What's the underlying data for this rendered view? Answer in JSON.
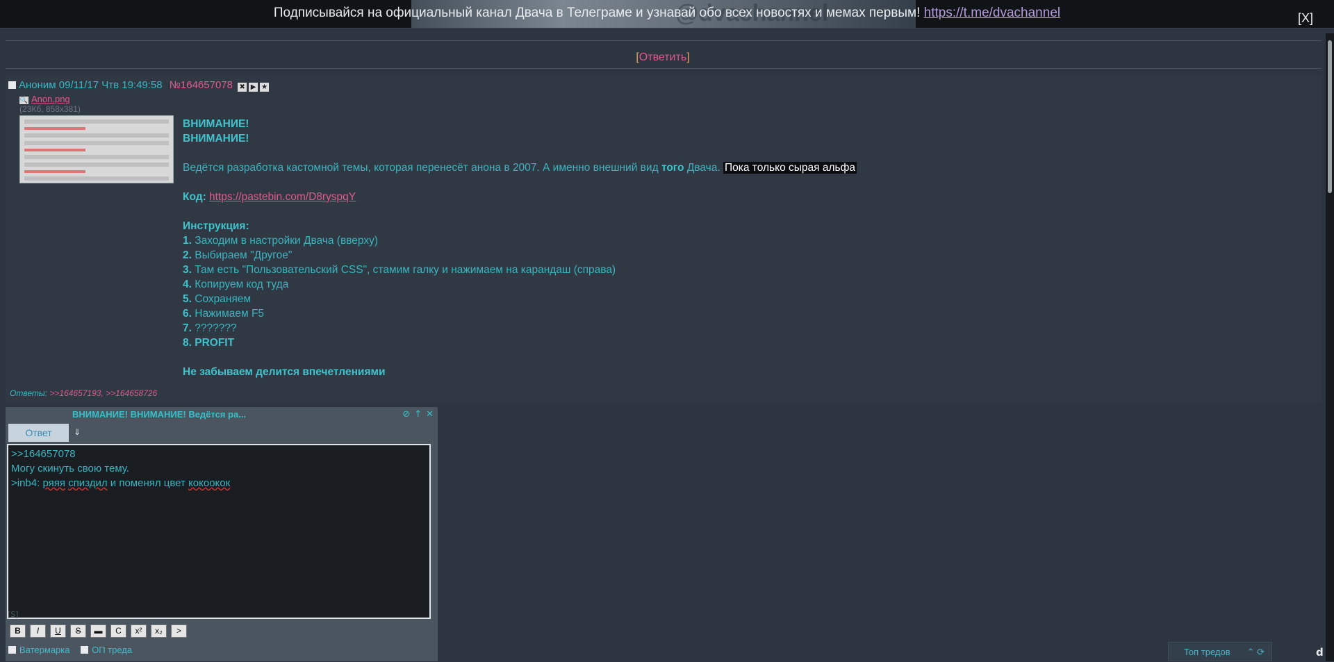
{
  "banner": {
    "text": "Подписывайся на официальный канал Двача в Телеграме и узнавай обо всех новостях и мемах первым!",
    "link": "https://t.me/dvachannel",
    "watermark": "@dvachannel",
    "close": "[X]"
  },
  "reply": {
    "open": "[",
    "label": "Ответить",
    "close": "]"
  },
  "post": {
    "author": "Аноним",
    "date": "09/11/17 Чтв 19:49:58",
    "number": "№164657078",
    "file_name": "Anon.png",
    "file_meta": "(23Кб, 858x381)",
    "lines": {
      "w1": "ВНИМАНИЕ!",
      "w2": "ВНИМАНИЕ!",
      "desc_a": "Ведётся разработка кастомной темы, которая перенесёт анона в 2007. А именно внешний вид ",
      "desc_b": "того",
      "desc_c": " Двача.",
      "desc_hl": "Пока только сырая альфа",
      "code_label": "Код:",
      "code_link": "https://pastebin.com/D8ryspqY",
      "instr": "Инструкция:",
      "steps": [
        {
          "n": "1.",
          "t": "Заходим в настройки Двача (вверху)"
        },
        {
          "n": "2.",
          "t": "Выбираем \"Другое\""
        },
        {
          "n": "3.",
          "t": "Там есть \"Пользовательский CSS\", стамим галку и нажимаем на карандаш (справа)"
        },
        {
          "n": "4.",
          "t": "Копируем код туда"
        },
        {
          "n": "5.",
          "t": "Сохраняем"
        },
        {
          "n": "6.",
          "t": "Нажимаем F5"
        },
        {
          "n": "7.",
          "t": "???????"
        },
        {
          "n": "8.",
          "t": "PROFIT"
        }
      ],
      "footer": "Не забываем делится впечетлениями"
    },
    "replies_label": "Ответы:",
    "replies": [
      ">>164657193,",
      ">>164658726"
    ]
  },
  "quick_reply": {
    "title": "ВНИМАНИЕ! ВНИМАНИЕ! Ведётся ра...",
    "button": "Ответ",
    "text_l1": ">>164657078",
    "text_l2": "Могу скинуть свою тему.",
    "text_l3a": ">inb4: ",
    "text_l3b": "ряяя",
    "text_l3c": " ",
    "text_l3d": "спиздил",
    "text_l3e": " и поменял цвет ",
    "text_l3f": "кокоокок",
    "note": "[S]",
    "format_buttons": [
      "B",
      "I",
      "U",
      "S",
      "▬",
      "C",
      "x²",
      "x₂",
      ">"
    ],
    "watermark_label": "Ватермарка",
    "op_label": "ОП треда"
  },
  "top_threads": {
    "label": "Топ тредов"
  }
}
